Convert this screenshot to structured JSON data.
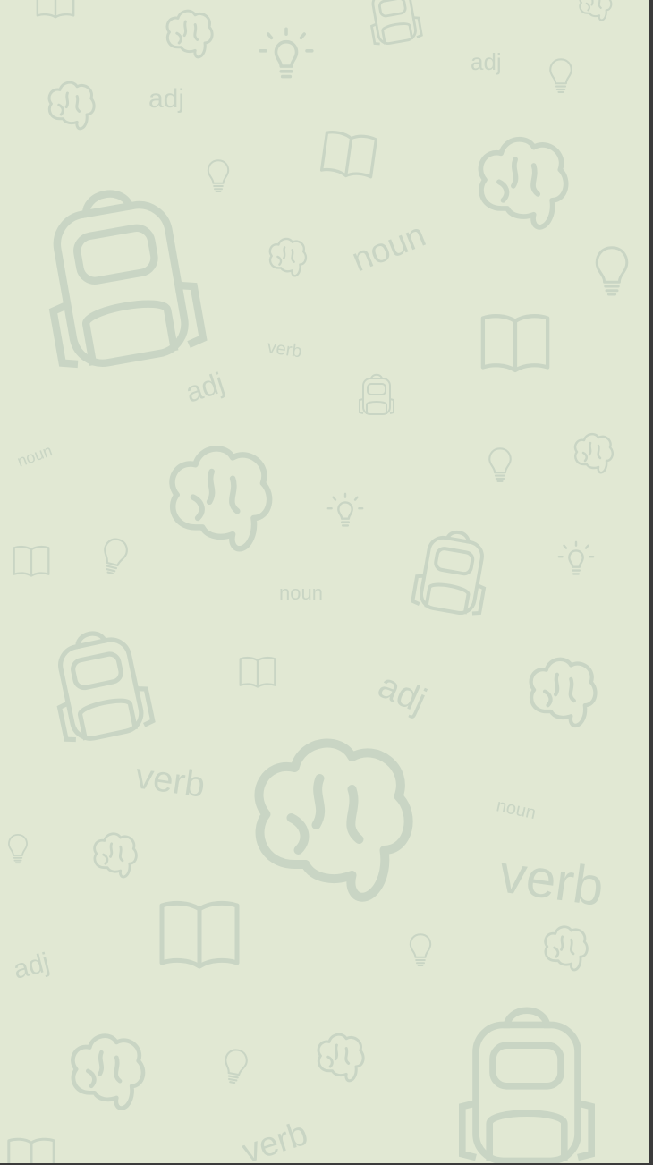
{
  "theme": {
    "background": "#e1e8d3",
    "doodle_color": "#c9d5c4"
  },
  "labels": {
    "adj": "adj",
    "noun": "noun",
    "verb": "verb"
  },
  "icons": [
    "book-icon",
    "brain-icon",
    "backpack-icon",
    "lightbulb-icon"
  ]
}
